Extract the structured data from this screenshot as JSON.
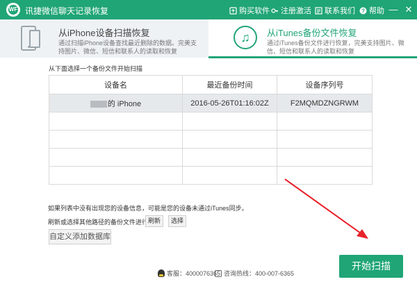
{
  "app": {
    "title": "讯捷微信聊天记录恢复",
    "logo_text": "WF"
  },
  "toolbar": {
    "buy": "购买软件",
    "register": "注册激活",
    "contact": "联系我们",
    "help": "帮助",
    "minimize": "—",
    "close": "✕"
  },
  "modes": {
    "iphone": {
      "title": "从iPhone设备扫描恢复",
      "desc": "通过扫描iPhone设备查找最近删除的数据。完美支持图片、微信、短信和联系人的读取和恢复"
    },
    "itunes": {
      "title": "从iTunes备份文件恢复",
      "desc": "通过iTunes备份文件进行恢复，完美支持图片、微信、短信和联系人的读取和恢复",
      "icon": "♫"
    }
  },
  "hint": "从下面选择一个备份文件开始扫描",
  "table": {
    "headers": [
      "设备名",
      "最近备份时间",
      "设备序列号"
    ],
    "rows": [
      {
        "name": "的 iPhone",
        "time": "2016-05-26T01:16:02Z",
        "serial": "F2MQMDZNGRWM"
      }
    ]
  },
  "notes": {
    "not_found": "如果列表中没有出现您的设备信息，可能是您的设备未通过iTunes同步。",
    "refresh_text": "刷新或选择其他路径的备份文件进行恢复。",
    "refresh_button": "刷新",
    "select_button": "选择",
    "add_db": "自定义添加数据库"
  },
  "start_button": "开始扫描",
  "footer": {
    "qq": "客服：4000076365",
    "hotline": "咨询热线：400-007-6365"
  },
  "colors": {
    "accent": "#20a577",
    "annotation_arrow": "#e8232a"
  }
}
